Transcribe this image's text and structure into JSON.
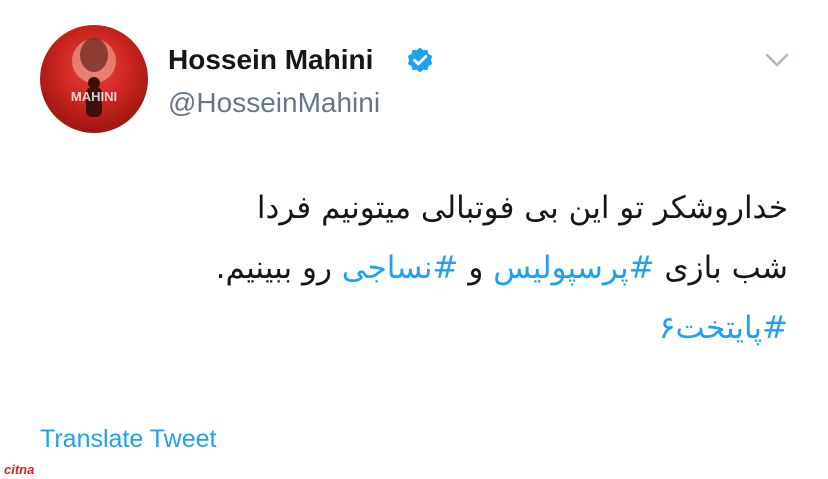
{
  "author": {
    "name": "Hossein Mahini",
    "handle": "@HosseinMahini",
    "avatar_text": "MAHINI"
  },
  "tweet": {
    "line1": "خداروشکر تو این بی فوتبالی میتونیم فردا",
    "line2_prefix": "شب بازی ",
    "hashtag1": "#پرسپولیس",
    "line2_mid": " و ",
    "hashtag2": "#نساجی",
    "line2_suffix": " رو ببینیم.",
    "hashtag3": "#پایتخت۶"
  },
  "actions": {
    "translate_label": "Translate Tweet"
  },
  "watermark": {
    "text": "citna"
  },
  "colors": {
    "link": "#1da1f2",
    "text": "#14171a",
    "secondary": "#657786",
    "verified": "#1da1f2"
  },
  "icons": [
    "verified-badge-icon",
    "chevron-down-icon"
  ]
}
